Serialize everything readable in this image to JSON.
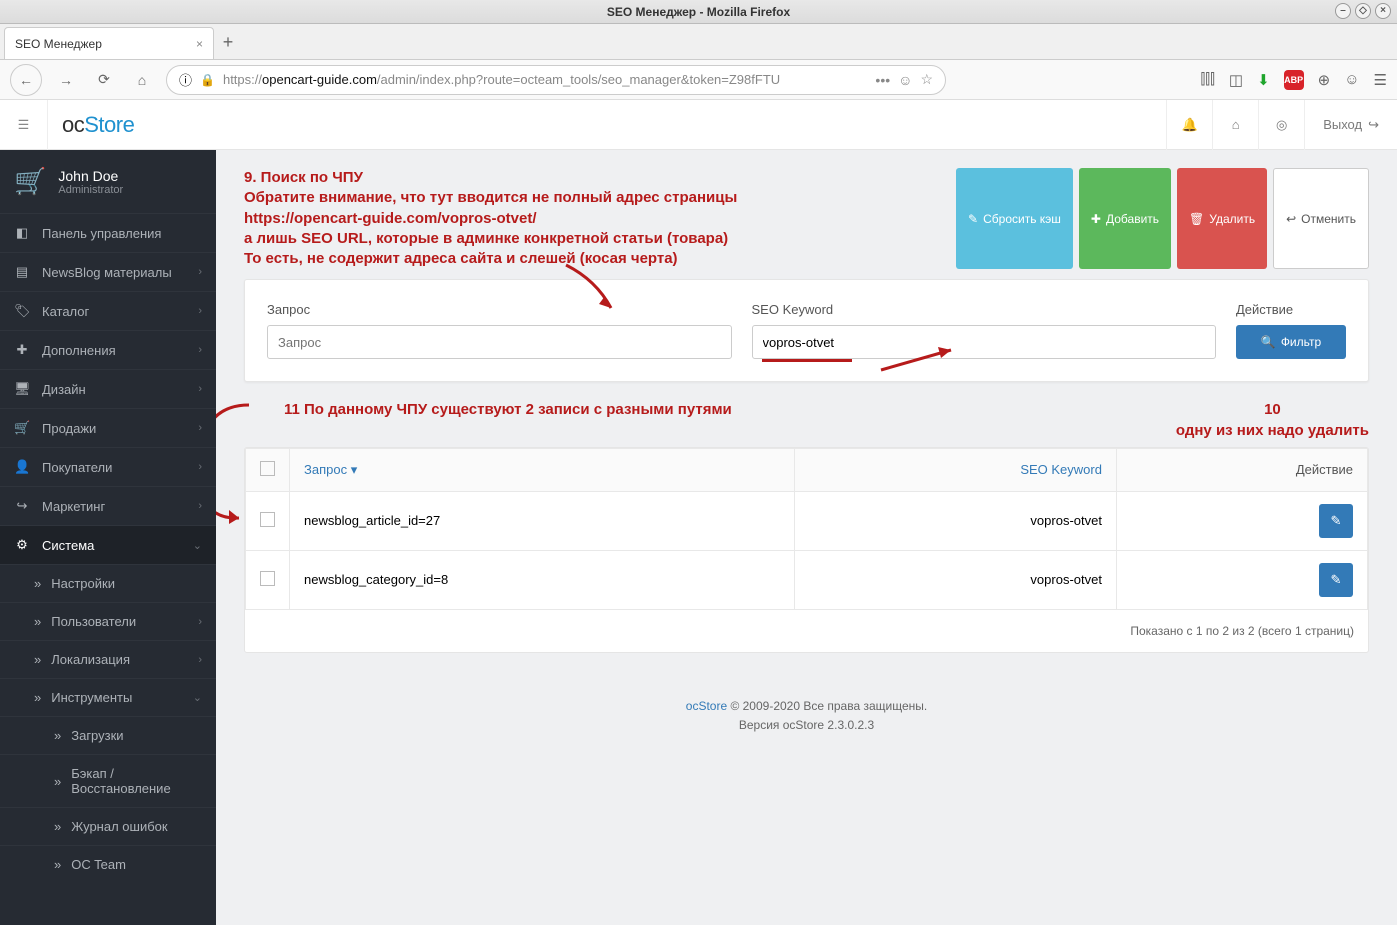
{
  "os": {
    "window_title": "SEO Менеджер - Mozilla Firefox"
  },
  "browser": {
    "tab_title": "SEO Менеджер",
    "url_prefix": "https://",
    "url_host": "opencart-guide.com",
    "url_path": "/admin/index.php?route=octeam_tools/seo_manager&token=Z98fFTU"
  },
  "header": {
    "logo1": "oc",
    "logo2": "Store",
    "logout": "Выход"
  },
  "sidebar": {
    "user_name": "John Doe",
    "user_role": "Administrator",
    "items": [
      {
        "icon": "◧",
        "label": "Панель управления"
      },
      {
        "icon": "▤",
        "label": "NewsBlog материалы",
        "caret": true
      },
      {
        "icon": "🏷",
        "label": "Каталог",
        "caret": true
      },
      {
        "icon": "✚",
        "label": "Дополнения",
        "caret": true
      },
      {
        "icon": "🖥",
        "label": "Дизайн",
        "caret": true
      },
      {
        "icon": "🛒",
        "label": "Продажи",
        "caret": true
      },
      {
        "icon": "👤",
        "label": "Покупатели",
        "caret": true
      },
      {
        "icon": "↪",
        "label": "Маркетинг",
        "caret": true
      },
      {
        "icon": "⚙",
        "label": "Система",
        "caret": true,
        "active": true
      }
    ],
    "subs": [
      {
        "label": "Настройки"
      },
      {
        "label": "Пользователи",
        "caret": true
      },
      {
        "label": "Локализация",
        "caret": true
      },
      {
        "label": "Инструменты",
        "caret": true,
        "open": true
      }
    ],
    "subs2": [
      {
        "label": "Загрузки"
      },
      {
        "label": "Бэкап / Восстановление"
      },
      {
        "label": "Журнал ошибок"
      },
      {
        "label": "OC Team"
      }
    ]
  },
  "annotations": {
    "block1_l1": "9. Поиск по ЧПУ",
    "block1_l2": "Обратите внимание, что тут вводится не полный адрес страницы",
    "block1_l3": "https://opencart-guide.com/vopros-otvet/",
    "block1_l4": "а лишь SEO URL, которые в админке конкретной статьи (товара)",
    "block1_l5": "То есть, не содержит адреса сайта и слешей (косая черта)",
    "left_text": "11 По данному ЧПУ существуют 2 записи с разными путями",
    "right_num": "10",
    "right_text": "одну из них надо удалить"
  },
  "buttons": {
    "reset": "Сбросить кэш",
    "add": "Добавить",
    "delete": "Удалить",
    "cancel": "Отменить",
    "filter": "Фильтр"
  },
  "filter": {
    "query_label": "Запрос",
    "query_placeholder": "Запрос",
    "seo_label": "SEO Keyword",
    "seo_value": "vopros-otvet",
    "action_label": "Действие"
  },
  "table": {
    "col_query": "Запрос",
    "col_seo": "SEO Keyword",
    "col_action": "Действие",
    "rows": [
      {
        "query": "newsblog_article_id=27",
        "seo": "vopros-otvet"
      },
      {
        "query": "newsblog_category_id=8",
        "seo": "vopros-otvet"
      }
    ],
    "pager": "Показано с 1 по 2 из 2 (всего 1 страниц)"
  },
  "footer": {
    "brand": "ocStore",
    "copy": " © 2009-2020 Все права защищены.",
    "version": "Версия ocStore 2.3.0.2.3"
  }
}
